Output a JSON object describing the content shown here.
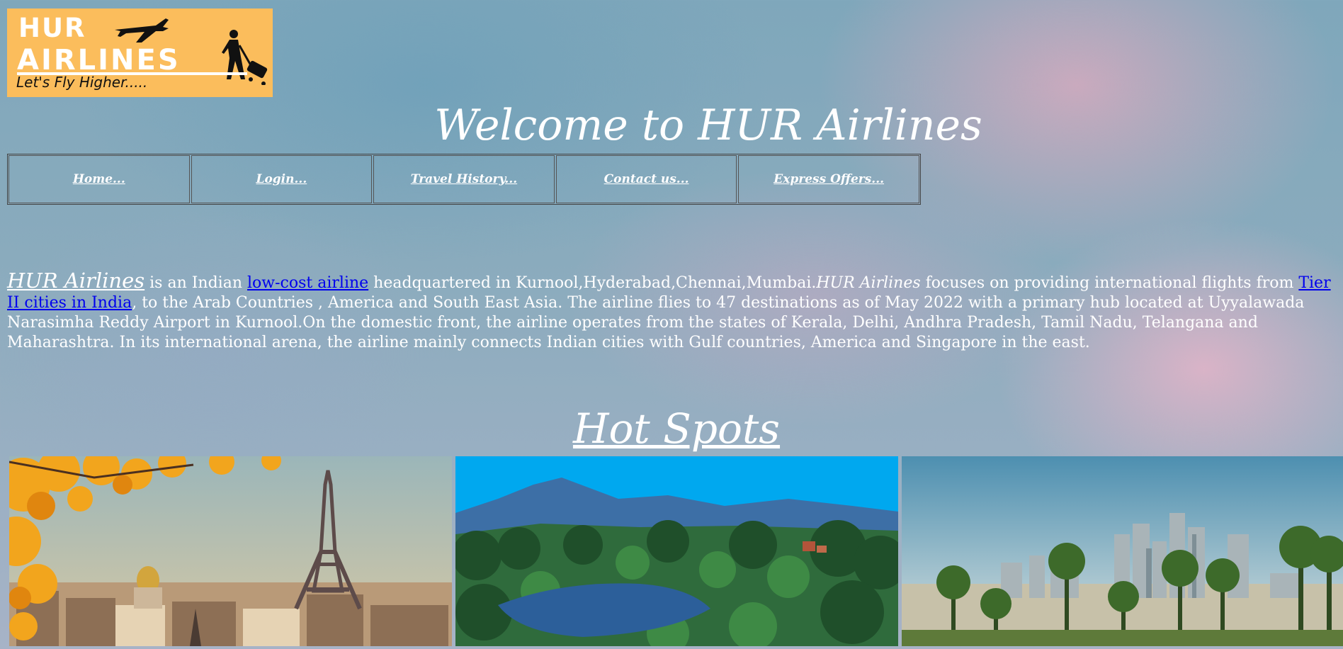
{
  "logo": {
    "line1": "HUR",
    "line2": "AIRLINES",
    "tagline": "Let's Fly Higher....."
  },
  "welcome": "Welcome to HUR Airlines",
  "nav": [
    {
      "label": "Home..."
    },
    {
      "label": "Login..."
    },
    {
      "label": "Travel History..."
    },
    {
      "label": "Contact us..."
    },
    {
      "label": "Express Offers..."
    }
  ],
  "intro": {
    "brand": "HUR Airlines",
    "t1": " is an Indian ",
    "link1": "low-cost airline",
    "t2": " headquartered in Kurnool,Hyderabad,Chennai,Mumbai.",
    "brand2": "HUR Airlines",
    "t3": " focuses on providing international flights from ",
    "link2": "Tier II cities in India",
    "t4": ", to the Arab Countries , America and South East Asia. The airline flies to 47 destinations as of May 2022 with a primary hub located at Uyyalawada Narasimha Reddy Airport in Kurnool.On the domestic front, the airline operates from the states of Kerala, Delhi, Andhra Pradesh, Tamil Nadu, Telangana and Maharashtra. In its international arena, the airline mainly connects Indian cities with Gulf countries, America and Singapore in the east."
  },
  "hotspots_title": "Hot Spots",
  "colors": {
    "logo_bg": "#fbbd5c",
    "link": "#0000ee",
    "text": "#ffffff"
  }
}
